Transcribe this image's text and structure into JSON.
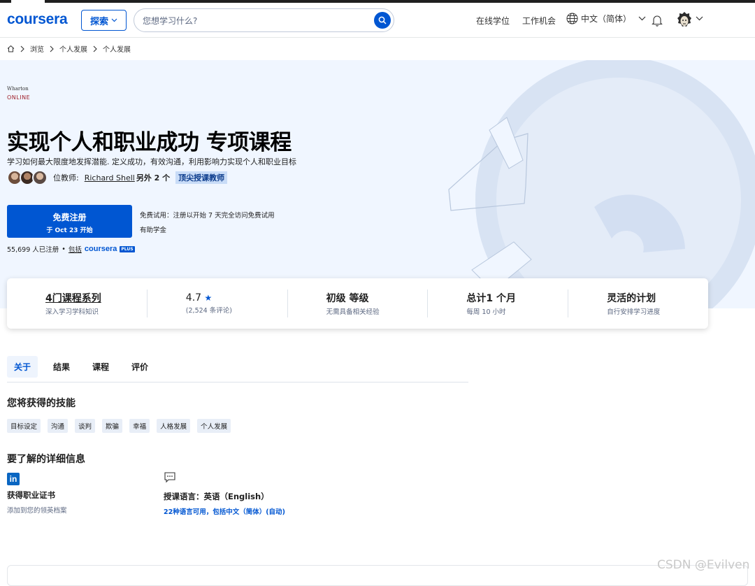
{
  "header": {
    "logo": "coursera",
    "explore_label": "探索",
    "search_placeholder": "您想学习什么?",
    "nav": [
      "在线学位",
      "工作机会"
    ],
    "language": "中文（简体）"
  },
  "breadcrumb": [
    "浏览",
    "个人发展",
    "个人发展"
  ],
  "hero": {
    "partner_line1": "Wharton",
    "partner_line2": "ONLINE",
    "title": "实现个人和职业成功 专项课程",
    "subtitle": "学习如何最大限度地发挥潜能. 定义成功，有效沟通，利用影响力实现个人和职业目标",
    "instructor_label": "位教师:",
    "instructor_name": "Richard Shell",
    "instructor_more": "另外 2 个",
    "top_badge": "顶尖授课教师",
    "enroll_line1": "免费注册",
    "enroll_line2": "于 Oct 23 开始",
    "trial_text": "免费试用：注册以开始 7 天完全访问免费试用",
    "aid_text": "有助学金",
    "enrolled_count": "55,699 人已注册",
    "included_label": "包括",
    "plus_logo": "coursera",
    "plus_tag": "PLUS"
  },
  "stats": [
    {
      "main": "4门课程系列",
      "sub": "深入学习学科知识"
    },
    {
      "main": "4.7",
      "sub": "(2,524 条评论)"
    },
    {
      "main": "初级 等级",
      "sub": "无需具备相关经验"
    },
    {
      "main": "总计1 个月",
      "sub": "每周 10 小时"
    },
    {
      "main": "灵活的计划",
      "sub": "自行安排学习进度"
    }
  ],
  "tabs": [
    "关于",
    "结果",
    "课程",
    "评价"
  ],
  "skills": {
    "heading": "您将获得的技能",
    "items": [
      "目标设定",
      "沟通",
      "谈判",
      "欺骗",
      "幸福",
      "人格发展",
      "个人发展"
    ]
  },
  "details": {
    "heading": "要了解的详细信息",
    "certificate_title": "获得职业证书",
    "certificate_sub": "添加到您的领英档案",
    "linkedin_letters": "in",
    "language_title": "授课语言：英语（English）",
    "language_sub": "22种语言可用，包括中文（简体）(自动)"
  },
  "watermark": "CSDN @Evilven",
  "colors": {
    "brand": "#0056d2",
    "hero_bg": "#f0f6ff",
    "chip_bg": "#e8eef7"
  }
}
